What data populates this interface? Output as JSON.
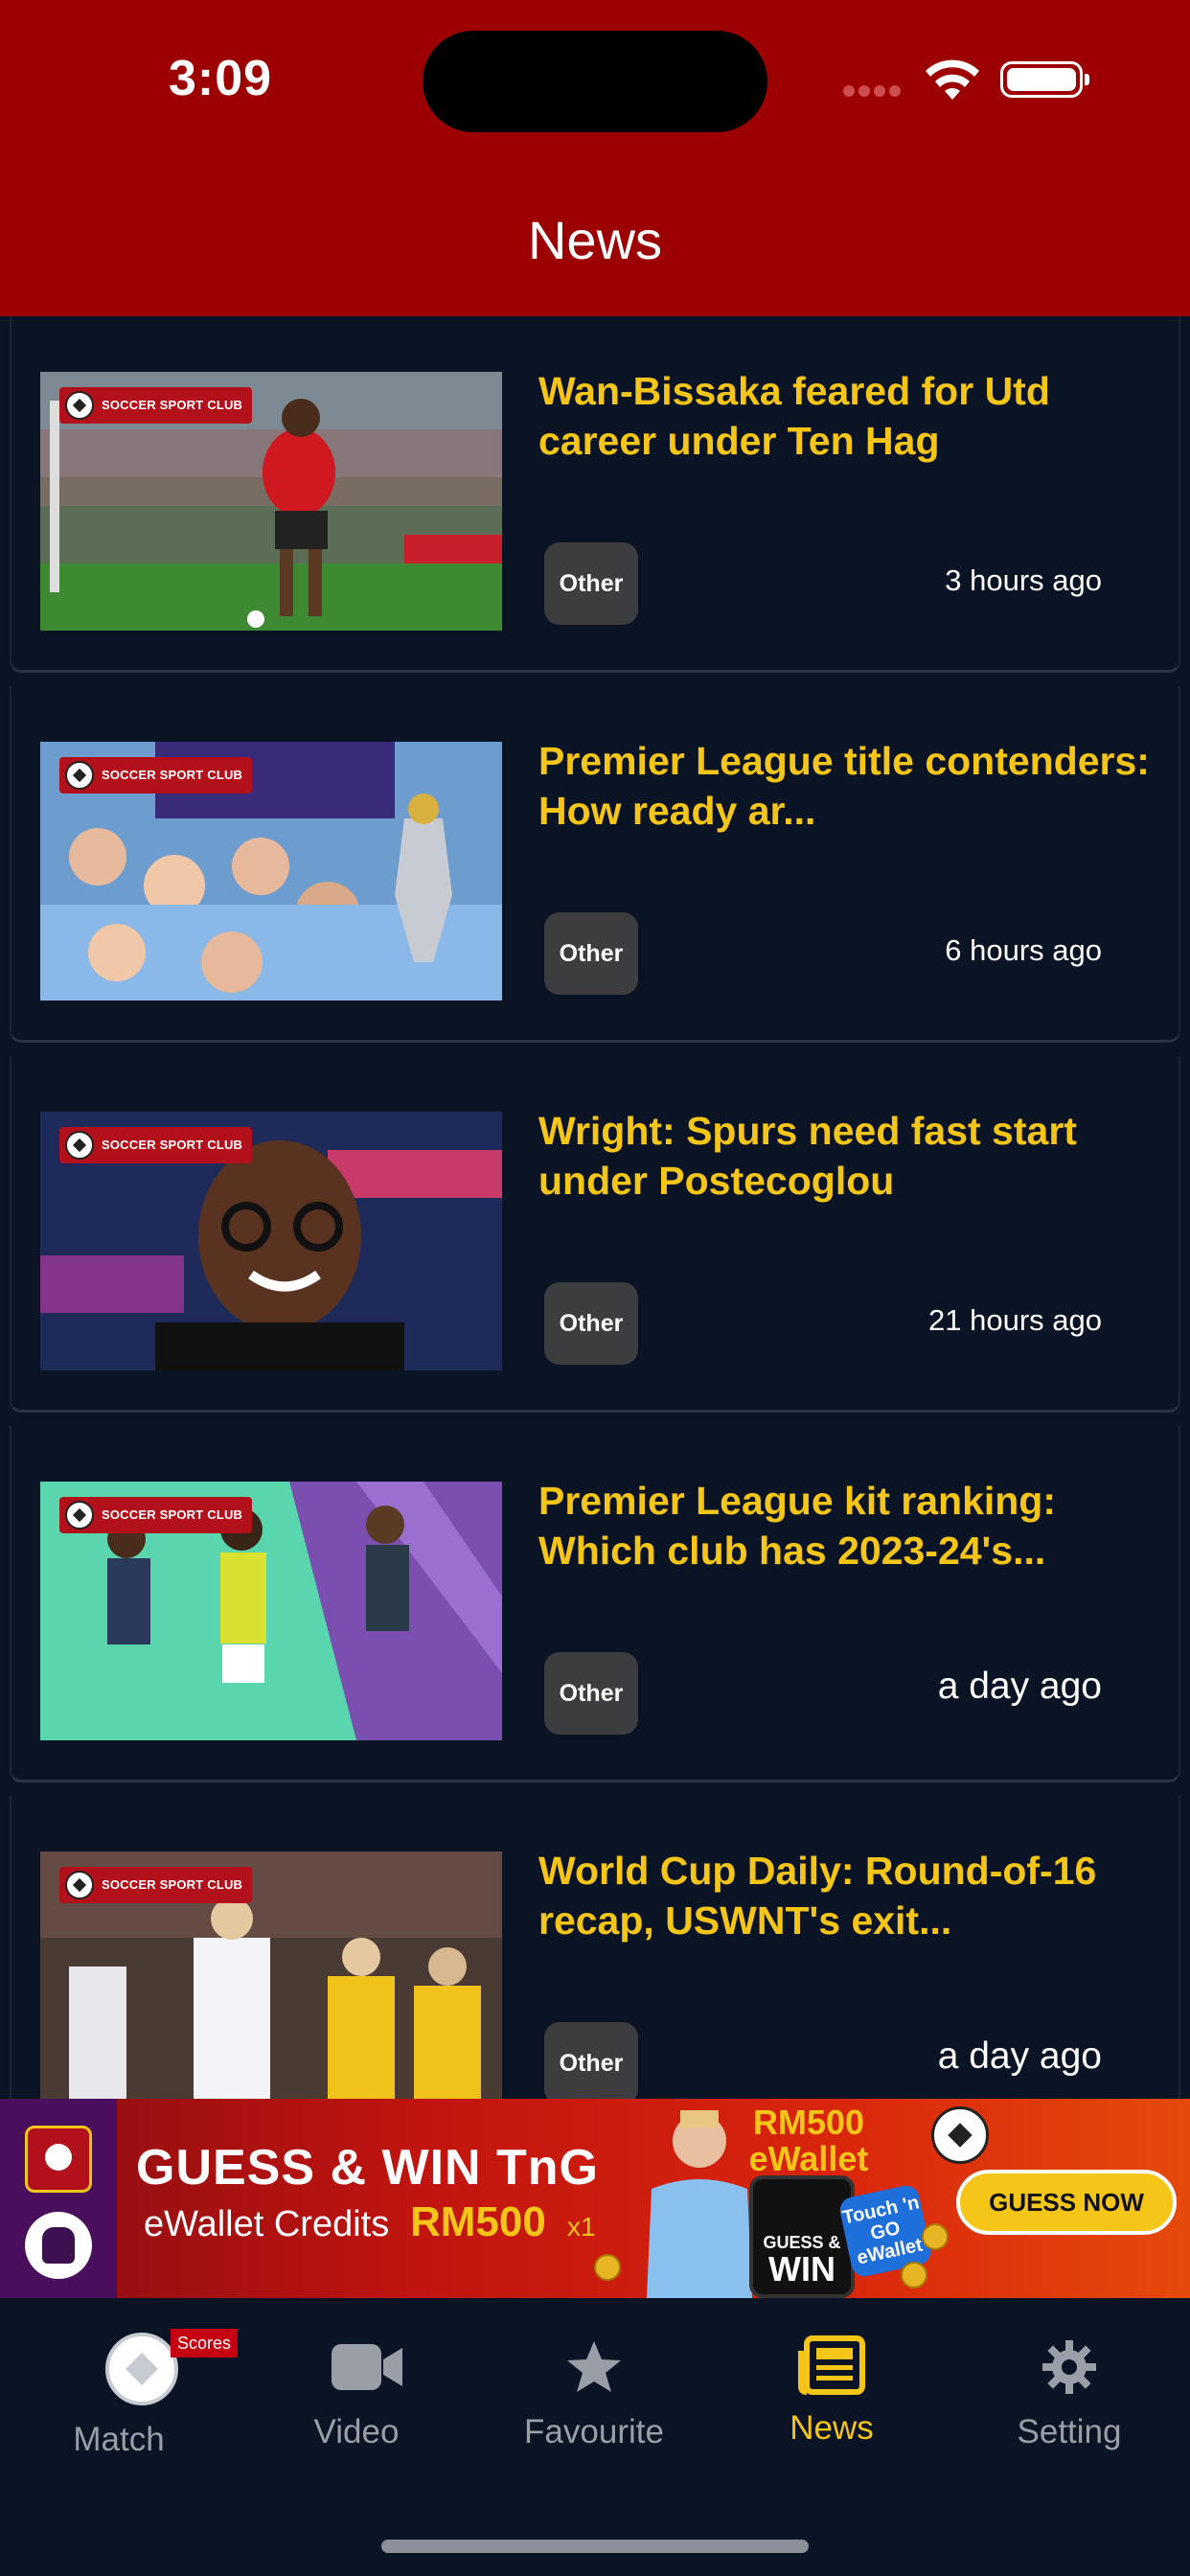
{
  "status_bar": {
    "time": "3:09"
  },
  "header": {
    "title": "News"
  },
  "brand_watermark": "SOCCER SPORT CLUB",
  "news": [
    {
      "headline": "Wan-Bissaka feared for Utd career under Ten Hag",
      "tag": "Other",
      "time_ago": "3 hours ago"
    },
    {
      "headline": "Premier League title contenders: How ready ar...",
      "tag": "Other",
      "time_ago": "6 hours ago"
    },
    {
      "headline": "Wright: Spurs need fast start under Postecoglou",
      "tag": "Other",
      "time_ago": "21 hours ago"
    },
    {
      "headline": "Premier League kit ranking: Which club has 2023-24's...",
      "tag": "Other",
      "time_ago": "a day ago"
    },
    {
      "headline": "World Cup Daily: Round-of-16 recap, USWNT's exit...",
      "tag": "Other",
      "time_ago": "a day ago"
    }
  ],
  "banner": {
    "headline": "GUESS & WIN TnG",
    "subtitle": "eWallet Credits",
    "amount": "RM500",
    "multiplier": "x1",
    "prize_line1": "RM500",
    "prize_line2": "eWallet",
    "phone_text_small": "GUESS &",
    "phone_text_big": "WIN",
    "tng_text": "Touch 'n GO eWallet",
    "cta": "GUESS NOW"
  },
  "tabs": [
    {
      "id": "match",
      "label": "Match",
      "badge": "Scores",
      "icon": "soccer-ball-icon"
    },
    {
      "id": "video",
      "label": "Video",
      "icon": "video-camera-icon"
    },
    {
      "id": "favourite",
      "label": "Favourite",
      "icon": "star-icon"
    },
    {
      "id": "news",
      "label": "News",
      "icon": "newspaper-icon",
      "active": true
    },
    {
      "id": "setting",
      "label": "Setting",
      "icon": "gear-icon"
    }
  ],
  "colors": {
    "header": "#9c0001",
    "background": "#0b1424",
    "headline": "#f5c518",
    "tag": "#3d3d3f",
    "tab_active": "#f5c518",
    "tab_inactive": "#9a9ea6"
  }
}
